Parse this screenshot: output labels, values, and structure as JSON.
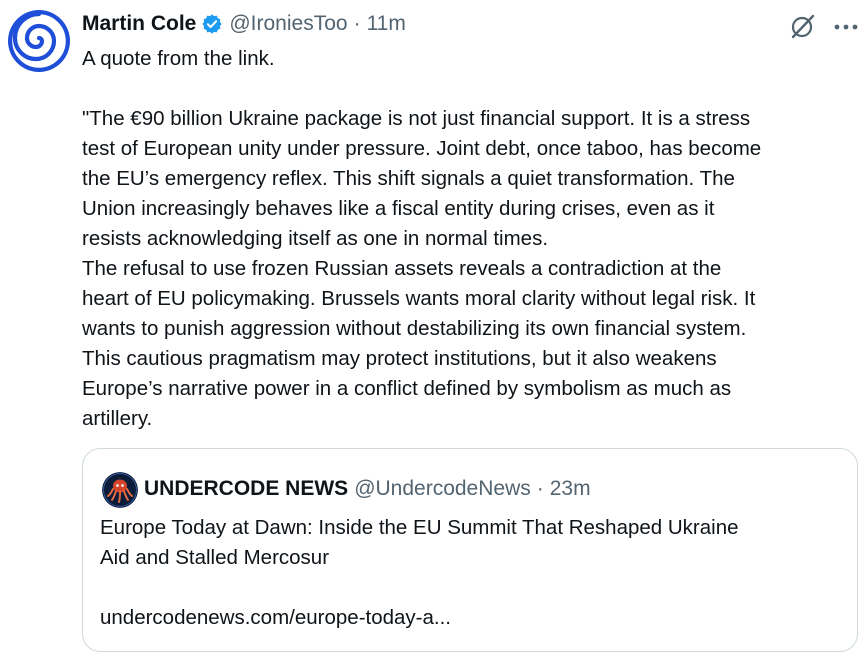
{
  "post": {
    "author_name": "Martin Cole",
    "author_handle": "@IroniesToo",
    "separator": "·",
    "time": "11m",
    "lines": [
      "A quote from the link.",
      "",
      "\"The €90 billion Ukraine package is not just financial support. It is a stress",
      "test of European unity under pressure. Joint debt, once taboo, has become",
      "the EU’s emergency reflex. This shift signals a quiet transformation. The",
      "Union increasingly behaves like a fiscal entity during crises, even as it",
      "resists acknowledging itself as one in normal times.",
      "The refusal to use frozen Russian assets reveals a contradiction at the",
      "heart of EU policymaking. Brussels wants moral clarity without legal risk. It",
      "wants to punish aggression without destabilizing its own financial system.",
      "This cautious pragmatism may protect institutions, but it also weakens",
      "Europe’s narrative power in a conflict defined by symbolism as much as",
      "artillery."
    ]
  },
  "quoted": {
    "author_name": "UNDERCODE NEWS",
    "author_handle": "@UndercodeNews",
    "separator": "·",
    "time": "23m",
    "lines": [
      "Europe Today at Dawn: Inside the EU Summit That Reshaped Ukraine",
      "Aid and Stalled Mercosur",
      "",
      "undercodenews.com/europe-today-a..."
    ]
  },
  "colors": {
    "text": "#0f1419",
    "secondary": "#536471",
    "verified": "#1d9bf0",
    "avatar_spiral": "#1f4fd8",
    "border": "#cfd9de"
  },
  "icons": {
    "verified": "verified-badge-icon",
    "grok": "grok-icon",
    "more": "more-dots-icon",
    "avatar": "spiral-avatar",
    "quoted_avatar": "octopus-logo-avatar"
  }
}
